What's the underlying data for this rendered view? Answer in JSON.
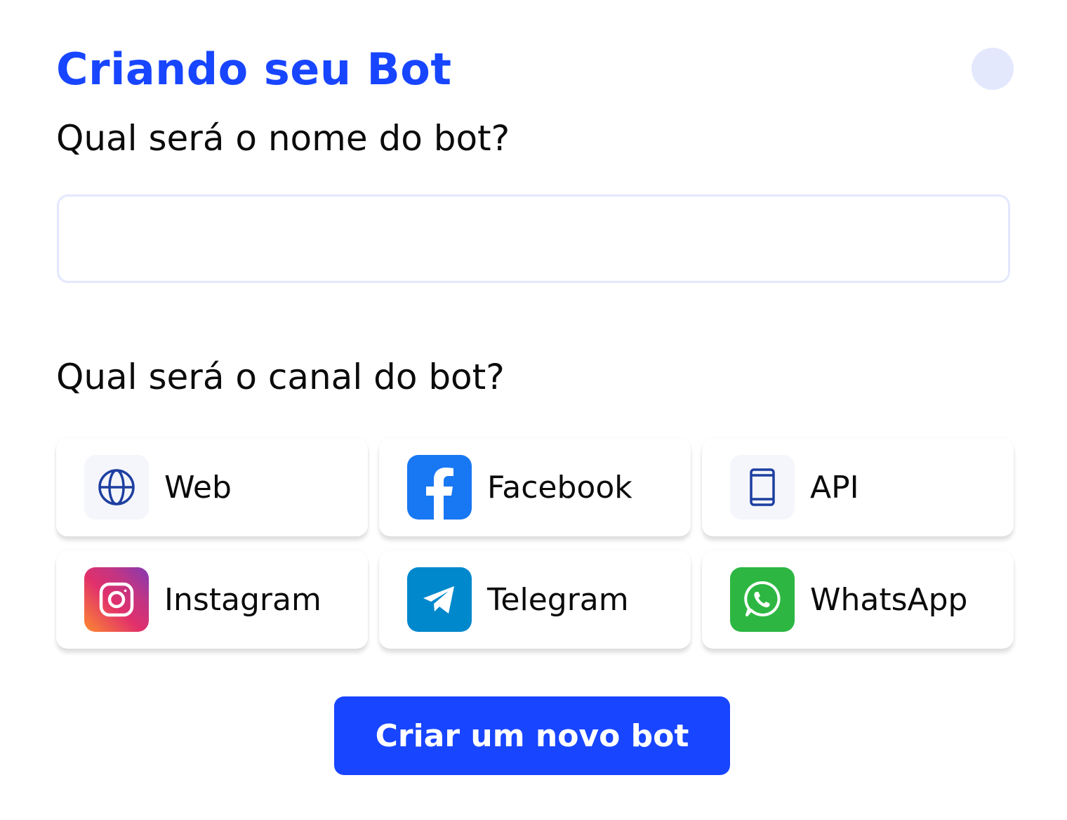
{
  "header": {
    "title": "Criando seu Bot"
  },
  "form": {
    "name_question": "Qual será o nome do bot?",
    "name_value": "",
    "channel_question": "Qual será o canal do bot?"
  },
  "channels": [
    {
      "label": "Web",
      "icon": "globe-icon"
    },
    {
      "label": "Facebook",
      "icon": "facebook-icon",
      "color": "#1877f2"
    },
    {
      "label": "API",
      "icon": "mobile-device-icon"
    },
    {
      "label": "Instagram",
      "icon": "instagram-icon"
    },
    {
      "label": "Telegram",
      "icon": "telegram-icon",
      "color": "#0088cc"
    },
    {
      "label": "WhatsApp",
      "icon": "whatsapp-icon",
      "color": "#2db742"
    }
  ],
  "actions": {
    "create_label": "Criar um novo bot"
  },
  "colors": {
    "accent": "#1845ff",
    "soft": "#e3e8fd",
    "icon_blue": "#1d3fa0"
  }
}
